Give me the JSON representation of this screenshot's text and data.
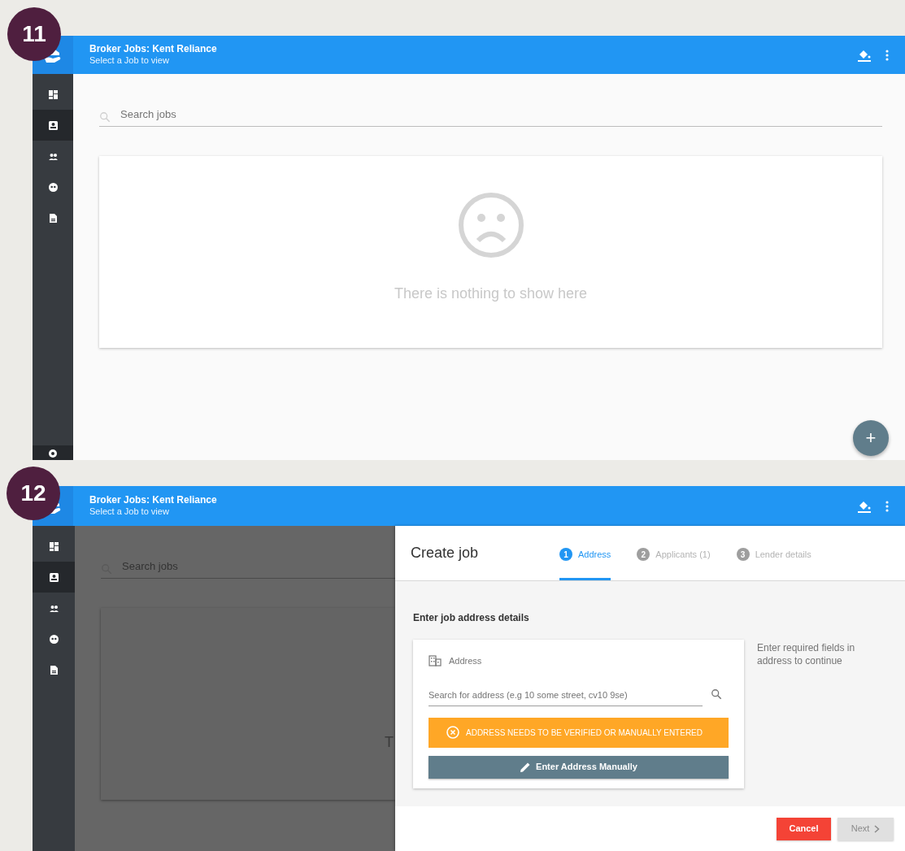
{
  "screens": [
    {
      "badge": "11",
      "app_bar": {
        "title": "Broker Jobs: Kent Reliance",
        "subtitle": "Select a Job to view"
      },
      "sidebar": [
        {
          "kind": "dashboard",
          "selected": false
        },
        {
          "kind": "contact",
          "selected": true
        },
        {
          "kind": "people",
          "selected": false
        },
        {
          "kind": "face",
          "selected": false
        },
        {
          "kind": "document",
          "selected": false
        }
      ],
      "search": {
        "placeholder": "Search jobs"
      },
      "empty_state": {
        "message": "There is nothing to show here"
      },
      "fab": "+"
    },
    {
      "badge": "12",
      "app_bar": {
        "title": "Broker Jobs: Kent Reliance",
        "subtitle": "Select a Job to view"
      },
      "sidebar": [
        {
          "kind": "dashboard",
          "selected": false
        },
        {
          "kind": "contact",
          "selected": true
        },
        {
          "kind": "people",
          "selected": false
        },
        {
          "kind": "face",
          "selected": false
        },
        {
          "kind": "document",
          "selected": false
        }
      ],
      "search": {
        "placeholder": "Search jobs"
      },
      "empty_state": {
        "message": "T"
      },
      "drawer": {
        "title": "Create job",
        "steps": [
          {
            "number": "1",
            "label": "Address",
            "selected": true
          },
          {
            "number": "2",
            "label": "Applicants (1)",
            "selected": false
          },
          {
            "number": "3",
            "label": "Lender details",
            "selected": false
          }
        ],
        "section_title": "Enter job address details",
        "address_card": {
          "label": "Address",
          "search": {
            "placeholder": "Search for address (e.g 10 some street, cv10 9se)"
          },
          "warning": "ADDRESS NEEDS TO BE VERIFIED OR MANUALLY ENTERED",
          "manual_button": "Enter Address Manually"
        },
        "hint": "Enter required fields in address to continue",
        "actions": [
          {
            "kind": "cancel",
            "label": "Cancel",
            "disabled": false
          },
          {
            "kind": "next",
            "label": "Next",
            "disabled": true
          }
        ]
      }
    }
  ]
}
